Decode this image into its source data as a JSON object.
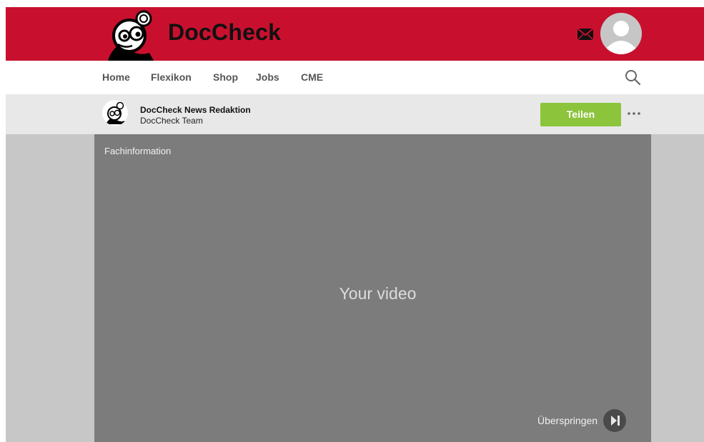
{
  "header": {
    "brand": "DocCheck",
    "colors": {
      "brand_red": "#c8102e",
      "share_green": "#8cc43c"
    },
    "icons": {
      "logo": "doccheck-mascot-icon",
      "mail": "mail-icon",
      "avatar": "user-avatar"
    }
  },
  "nav": {
    "items": [
      "Home",
      "Flexikon",
      "Shop",
      "Jobs",
      "CME"
    ],
    "search_icon": "search-icon"
  },
  "author": {
    "name": "DocCheck News Redaktion",
    "team": "DocCheck Team",
    "share_label": "Teilen",
    "more_icon": "more-dots-icon"
  },
  "player": {
    "label": "Fachinformation",
    "placeholder": "Your video",
    "skip_label": "Überspringen",
    "skip_icon": "skip-forward-icon"
  }
}
